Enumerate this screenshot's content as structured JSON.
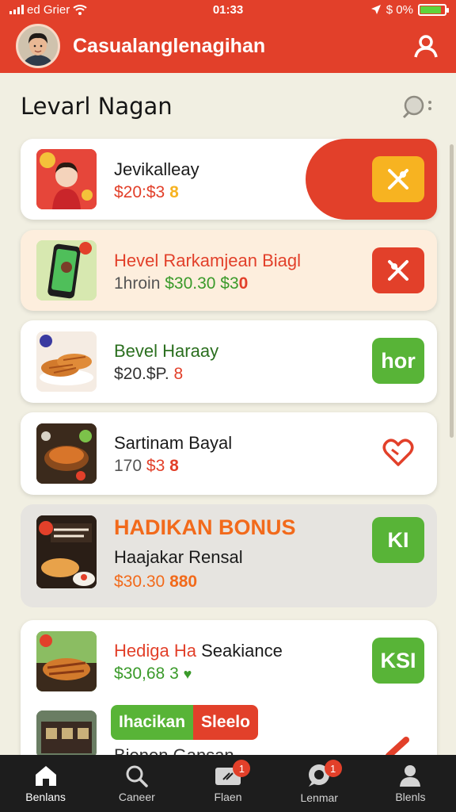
{
  "status": {
    "carrier": "ed Grier",
    "time": "01:33",
    "battery_text": "$ 0%",
    "battery_level": 0.85
  },
  "app": {
    "title": "Casualanglenagihan"
  },
  "section": {
    "title": "Levarl Nagan"
  },
  "items": [
    {
      "name": "Jevikalleay",
      "price": "$20:$3",
      "price_suffix": "8",
      "action": "sparkle-icon",
      "action_color": "#f7b321"
    },
    {
      "name": "Hevel Rarkamjean Biagl",
      "meta": "1hroin",
      "price": "$30.30 $3",
      "price_suffix": "0",
      "action": "sparkle-icon",
      "action_color": "#e2402a"
    },
    {
      "name": "Bevel Haraay",
      "price": "$20.$P.",
      "price_suffix": "8",
      "action_label": "hor",
      "action_color": "#58b437"
    },
    {
      "name": "Sartinam Bayal",
      "price_meta": "170",
      "price": "$3",
      "price_suffix": "8",
      "action": "heart-icon"
    },
    {
      "promo": "HADIKAN BONUS",
      "name": "Haajakar Rensal",
      "price": "$30.30",
      "price_suffix": "880",
      "action_label": "KI",
      "action_color": "#58b437"
    },
    {
      "name_red": "Hediga Ha",
      "name_dark": "Seakiance",
      "price": "$30,68 3",
      "action_label": "KSI",
      "action_color": "#58b437"
    },
    {
      "chip_left": "Ihacikan",
      "chip_right": "Sleelo",
      "partial_text": "Bienen Gansan",
      "action": "pencil-icon"
    }
  ],
  "tabs": [
    {
      "label": "Benlans",
      "icon": "home-icon",
      "active": true
    },
    {
      "label": "Caneer",
      "icon": "search-icon"
    },
    {
      "label": "Flaen",
      "icon": "ticket-icon",
      "badge": "1"
    },
    {
      "label": "Lenmar",
      "icon": "chat-icon",
      "badge": "1"
    },
    {
      "label": "Blenls",
      "icon": "profile-icon"
    }
  ],
  "colors": {
    "brand": "#e2402a",
    "green": "#58b437",
    "yellow": "#f7b321",
    "price_red": "#e2402a",
    "price_green": "#3a9a2a",
    "background": "#f1efe2"
  }
}
